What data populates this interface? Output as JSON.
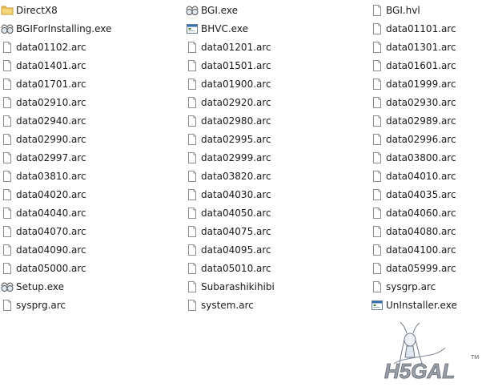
{
  "files": [
    {
      "name": "DirectX8",
      "type": "folder"
    },
    {
      "name": "BGI.exe",
      "type": "exe-glasses"
    },
    {
      "name": "BGI.hvl",
      "type": "file"
    },
    {
      "name": "BGIForInstalling.exe",
      "type": "exe-glasses"
    },
    {
      "name": "BHVC.exe",
      "type": "exe-window"
    },
    {
      "name": "data01101.arc",
      "type": "file"
    },
    {
      "name": "data01102.arc",
      "type": "file"
    },
    {
      "name": "data01201.arc",
      "type": "file"
    },
    {
      "name": "data01301.arc",
      "type": "file"
    },
    {
      "name": "data01401.arc",
      "type": "file"
    },
    {
      "name": "data01501.arc",
      "type": "file"
    },
    {
      "name": "data01601.arc",
      "type": "file"
    },
    {
      "name": "data01701.arc",
      "type": "file"
    },
    {
      "name": "data01900.arc",
      "type": "file"
    },
    {
      "name": "data01999.arc",
      "type": "file"
    },
    {
      "name": "data02910.arc",
      "type": "file"
    },
    {
      "name": "data02920.arc",
      "type": "file"
    },
    {
      "name": "data02930.arc",
      "type": "file"
    },
    {
      "name": "data02940.arc",
      "type": "file"
    },
    {
      "name": "data02980.arc",
      "type": "file"
    },
    {
      "name": "data02989.arc",
      "type": "file"
    },
    {
      "name": "data02990.arc",
      "type": "file"
    },
    {
      "name": "data02995.arc",
      "type": "file"
    },
    {
      "name": "data02996.arc",
      "type": "file"
    },
    {
      "name": "data02997.arc",
      "type": "file"
    },
    {
      "name": "data02999.arc",
      "type": "file"
    },
    {
      "name": "data03800.arc",
      "type": "file"
    },
    {
      "name": "data03810.arc",
      "type": "file"
    },
    {
      "name": "data03820.arc",
      "type": "file"
    },
    {
      "name": "data04010.arc",
      "type": "file"
    },
    {
      "name": "data04020.arc",
      "type": "file"
    },
    {
      "name": "data04030.arc",
      "type": "file"
    },
    {
      "name": "data04035.arc",
      "type": "file"
    },
    {
      "name": "data04040.arc",
      "type": "file"
    },
    {
      "name": "data04050.arc",
      "type": "file"
    },
    {
      "name": "data04060.arc",
      "type": "file"
    },
    {
      "name": "data04070.arc",
      "type": "file"
    },
    {
      "name": "data04075.arc",
      "type": "file"
    },
    {
      "name": "data04080.arc",
      "type": "file"
    },
    {
      "name": "data04090.arc",
      "type": "file"
    },
    {
      "name": "data04095.arc",
      "type": "file"
    },
    {
      "name": "data04100.arc",
      "type": "file"
    },
    {
      "name": "data05000.arc",
      "type": "file"
    },
    {
      "name": "data05010.arc",
      "type": "file"
    },
    {
      "name": "data05999.arc",
      "type": "file"
    },
    {
      "name": "Setup.exe",
      "type": "exe-glasses"
    },
    {
      "name": "Subarashikihibi",
      "type": "file"
    },
    {
      "name": "sysgrp.arc",
      "type": "file"
    },
    {
      "name": "sysprg.arc",
      "type": "file"
    },
    {
      "name": "system.arc",
      "type": "file"
    },
    {
      "name": "UnInstaller.exe",
      "type": "exe-window"
    }
  ],
  "watermark": {
    "logo_text": "H5GAL",
    "trademark": "TM"
  },
  "colors": {
    "folder": "#e8c25a",
    "folder_dark": "#c99a2e",
    "file_border": "#8c8c8c",
    "window_blue": "#2f6fb3",
    "logo_gray": "#8a8f98"
  }
}
